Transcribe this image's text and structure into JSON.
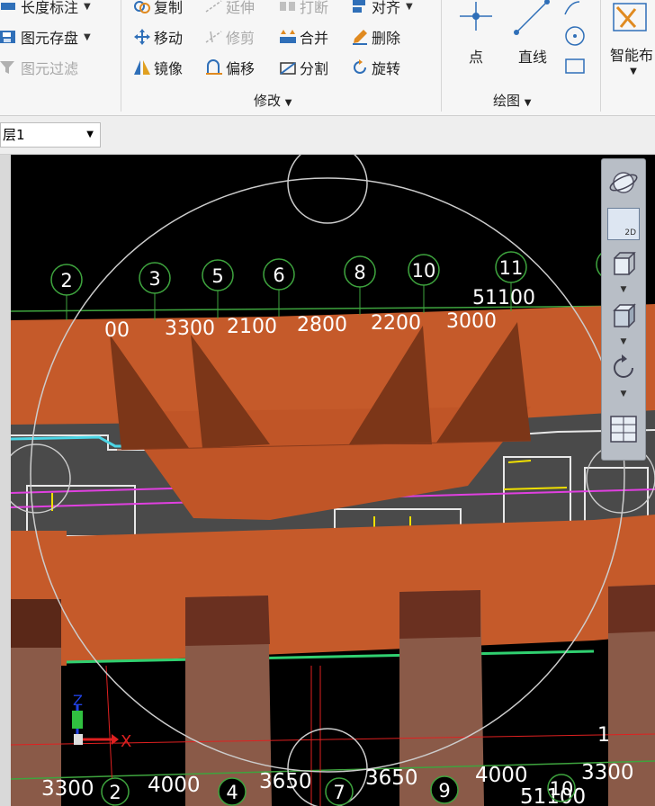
{
  "ribbon": {
    "left_items": [
      {
        "label": "长度标注",
        "disabled": false,
        "dropdown": true
      },
      {
        "label": "图元存盘",
        "disabled": false,
        "dropdown": true
      },
      {
        "label": "图元过滤",
        "disabled": true,
        "dropdown": false
      }
    ],
    "modify": {
      "group_label": "修改",
      "items": [
        {
          "label": "复制",
          "icon": "copy-icon",
          "disabled": false
        },
        {
          "label": "延伸",
          "icon": "extend-icon",
          "disabled": true
        },
        {
          "label": "打断",
          "icon": "break-icon",
          "disabled": true
        },
        {
          "label": "对齐",
          "icon": "align-icon",
          "disabled": false,
          "dropdown": true
        },
        {
          "label": "移动",
          "icon": "move-icon",
          "disabled": false
        },
        {
          "label": "修剪",
          "icon": "trim-icon",
          "disabled": true
        },
        {
          "label": "合并",
          "icon": "merge-icon",
          "disabled": false
        },
        {
          "label": "删除",
          "icon": "delete-icon",
          "disabled": false
        },
        {
          "label": "镜像",
          "icon": "mirror-icon",
          "disabled": false
        },
        {
          "label": "偏移",
          "icon": "offset-icon",
          "disabled": false
        },
        {
          "label": "分割",
          "icon": "split-icon",
          "disabled": false
        },
        {
          "label": "旋转",
          "icon": "rotate-icon",
          "disabled": false
        }
      ]
    },
    "draw": {
      "group_label": "绘图",
      "point_label": "点",
      "line_label": "直线"
    },
    "smart": {
      "label": "智能布"
    }
  },
  "layer_select": {
    "value": "层1"
  },
  "colors": {
    "beam": "#c55a2a",
    "beam_dark": "#7c3618",
    "column_side": "#8a5a48",
    "column_top": "#5a2818",
    "axis": "#3ea43e",
    "dim_text": "#ffffff",
    "slab": "#4a4a4a",
    "cyan_edge": "#4cd6e6",
    "magenta": "#e040e0",
    "yellow": "#f0e000",
    "viewcube_ring": "#cccccc"
  },
  "axis_bubbles_top": [
    "2",
    "3",
    "5",
    "6",
    "8",
    "10",
    "11",
    "1"
  ],
  "top_dims": {
    "total": "51100",
    "segments": [
      "00",
      "3300",
      "2100",
      "2800",
      "2200",
      "3000"
    ]
  },
  "axis_bubbles_bottom": [
    "2",
    "4",
    "7",
    "9",
    "10"
  ],
  "bottom_dims": {
    "segments": [
      "3300",
      "4000",
      "3650",
      "3650",
      "4000",
      "3300"
    ],
    "total": "51100"
  },
  "right_axis_label": "1",
  "ucs": {
    "x": "X",
    "z": "Z"
  },
  "navbar": {
    "mode2d": "2D"
  }
}
